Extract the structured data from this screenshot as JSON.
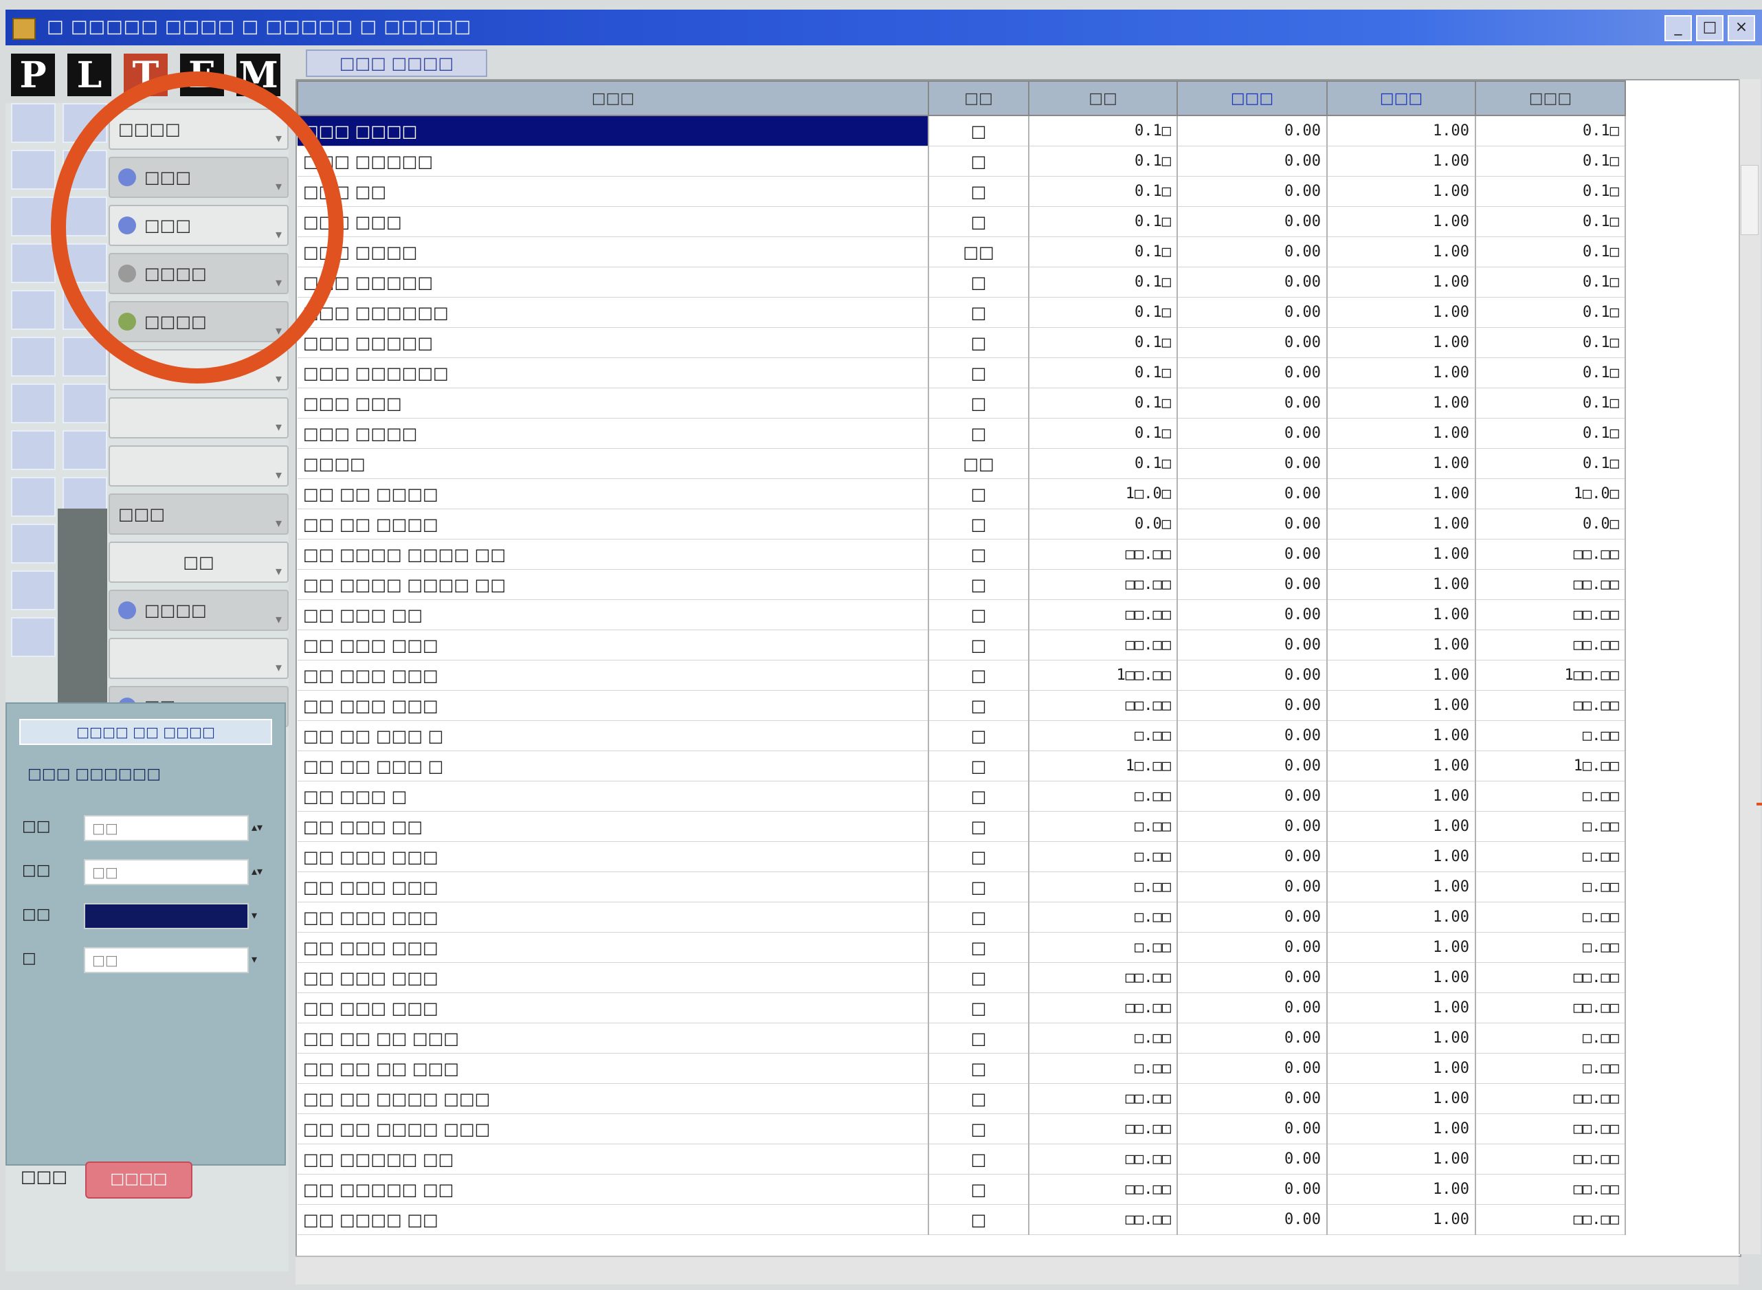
{
  "window": {
    "title": "□ □□□□□ □□□□ □ □□□□□ □ □□□□□",
    "controls": [
      "_",
      "□",
      "×"
    ]
  },
  "brand": {
    "letters": [
      "P",
      "L",
      "T",
      "E",
      "M"
    ]
  },
  "top_tab": {
    "label": "□□□ □□□□"
  },
  "sidebar": {
    "buttons": [
      {
        "label": "□□□□",
        "icon": "blank-icon"
      },
      {
        "label": "□□□",
        "icon": "page-icon"
      },
      {
        "label": "□□□",
        "icon": "page-icon"
      },
      {
        "label": "□□□□",
        "icon": "gear-icon"
      },
      {
        "label": "□□□□",
        "icon": "gear-icon"
      },
      {
        "label": "",
        "icon": "none"
      },
      {
        "label": "",
        "icon": "none"
      },
      {
        "label": "",
        "icon": "none"
      },
      {
        "label": "□□□",
        "icon": "none"
      },
      {
        "label": "□□",
        "icon": "none"
      },
      {
        "label": "□□□□",
        "icon": "person-icon"
      },
      {
        "label": "",
        "icon": "none"
      },
      {
        "label": "□□",
        "icon": "page-icon"
      }
    ]
  },
  "panel": {
    "header": "□□□□ □□ □□□□",
    "subtitle": "□□□ □□□□□□",
    "fields": [
      {
        "label": "□□",
        "value": "□□"
      },
      {
        "label": "□□",
        "value": "□□"
      },
      {
        "label": "□□",
        "value": ""
      },
      {
        "label": "□",
        "value": "□□"
      }
    ]
  },
  "footer": {
    "label": "□□□",
    "badge": "□□□□"
  },
  "table": {
    "columns": [
      "□□□",
      "□□",
      "□□",
      "□□□",
      "□□□",
      "□□□"
    ],
    "rows": [
      [
        "□□□ □□□□",
        "□",
        "0.1□",
        "0.00",
        "1.00",
        "0.1□"
      ],
      [
        "□□□ □□□□□",
        "□",
        "0.1□",
        "0.00",
        "1.00",
        "0.1□"
      ],
      [
        "□□□ □□",
        "□",
        "0.1□",
        "0.00",
        "1.00",
        "0.1□"
      ],
      [
        "□□□ □□□",
        "□",
        "0.1□",
        "0.00",
        "1.00",
        "0.1□"
      ],
      [
        "□□□ □□□□",
        "□□",
        "0.1□",
        "0.00",
        "1.00",
        "0.1□"
      ],
      [
        "□□□ □□□□□",
        "□",
        "0.1□",
        "0.00",
        "1.00",
        "0.1□"
      ],
      [
        "□□□ □□□□□□",
        "□",
        "0.1□",
        "0.00",
        "1.00",
        "0.1□"
      ],
      [
        "□□□ □□□□□",
        "□",
        "0.1□",
        "0.00",
        "1.00",
        "0.1□"
      ],
      [
        "□□□ □□□□□□",
        "□",
        "0.1□",
        "0.00",
        "1.00",
        "0.1□"
      ],
      [
        "□□□ □□□",
        "□",
        "0.1□",
        "0.00",
        "1.00",
        "0.1□"
      ],
      [
        "□□□ □□□□",
        "□",
        "0.1□",
        "0.00",
        "1.00",
        "0.1□"
      ],
      [
        "□□□□",
        "□□",
        "0.1□",
        "0.00",
        "1.00",
        "0.1□"
      ],
      [
        "□□ □□ □□□□",
        "□",
        "1□.0□",
        "0.00",
        "1.00",
        "1□.0□"
      ],
      [
        "□□ □□ □□□□",
        "□",
        "0.0□",
        "0.00",
        "1.00",
        "0.0□"
      ],
      [
        "□□ □□□□ □□□□ □□",
        "□",
        "□□.□□",
        "0.00",
        "1.00",
        "□□.□□"
      ],
      [
        "□□ □□□□ □□□□ □□",
        "□",
        "□□.□□",
        "0.00",
        "1.00",
        "□□.□□"
      ],
      [
        "□□ □□□ □□",
        "□",
        "□□.□□",
        "0.00",
        "1.00",
        "□□.□□"
      ],
      [
        "□□ □□□ □□□",
        "□",
        "□□.□□",
        "0.00",
        "1.00",
        "□□.□□"
      ],
      [
        "□□ □□□ □□□",
        "□",
        "1□□.□□",
        "0.00",
        "1.00",
        "1□□.□□"
      ],
      [
        "□□ □□□ □□□",
        "□",
        "□□.□□",
        "0.00",
        "1.00",
        "□□.□□"
      ],
      [
        "□□ □□ □□□ □",
        "□",
        "□.□□",
        "0.00",
        "1.00",
        "□.□□"
      ],
      [
        "□□ □□ □□□ □",
        "□",
        "1□.□□",
        "0.00",
        "1.00",
        "1□.□□"
      ],
      [
        "□□ □□□ □",
        "□",
        "□.□□",
        "0.00",
        "1.00",
        "□.□□"
      ],
      [
        "□□ □□□ □□",
        "□",
        "□.□□",
        "0.00",
        "1.00",
        "□.□□"
      ],
      [
        "□□ □□□ □□□",
        "□",
        "□.□□",
        "0.00",
        "1.00",
        "□.□□"
      ],
      [
        "□□ □□□ □□□",
        "□",
        "□.□□",
        "0.00",
        "1.00",
        "□.□□"
      ],
      [
        "□□ □□□ □□□",
        "□",
        "□.□□",
        "0.00",
        "1.00",
        "□.□□"
      ],
      [
        "□□ □□□ □□□",
        "□",
        "□.□□",
        "0.00",
        "1.00",
        "□.□□"
      ],
      [
        "□□ □□□ □□□",
        "□",
        "□□.□□",
        "0.00",
        "1.00",
        "□□.□□"
      ],
      [
        "□□ □□□ □□□",
        "□",
        "□□.□□",
        "0.00",
        "1.00",
        "□□.□□"
      ],
      [
        "□□ □□ □□ □□□",
        "□",
        "□.□□",
        "0.00",
        "1.00",
        "□.□□"
      ],
      [
        "□□ □□ □□ □□□",
        "□",
        "□.□□",
        "0.00",
        "1.00",
        "□.□□"
      ],
      [
        "□□ □□ □□□□ □□□",
        "□",
        "□□.□□",
        "0.00",
        "1.00",
        "□□.□□"
      ],
      [
        "□□ □□ □□□□ □□□",
        "□",
        "□□.□□",
        "0.00",
        "1.00",
        "□□.□□"
      ],
      [
        "□□ □□□□□ □□",
        "□",
        "□□.□□",
        "0.00",
        "1.00",
        "□□.□□"
      ],
      [
        "□□ □□□□□ □□",
        "□",
        "□□.□□",
        "0.00",
        "1.00",
        "□□.□□"
      ],
      [
        "□□ □□□□ □□",
        "□",
        "□□.□□",
        "0.00",
        "1.00",
        "□□.□□"
      ]
    ]
  },
  "colors": {
    "titlebar": "#1b3fb8",
    "selection": "#07107a",
    "highlight_circle": "#e0521f",
    "badge": "#e27a83",
    "panel": "#9fb8bf"
  }
}
